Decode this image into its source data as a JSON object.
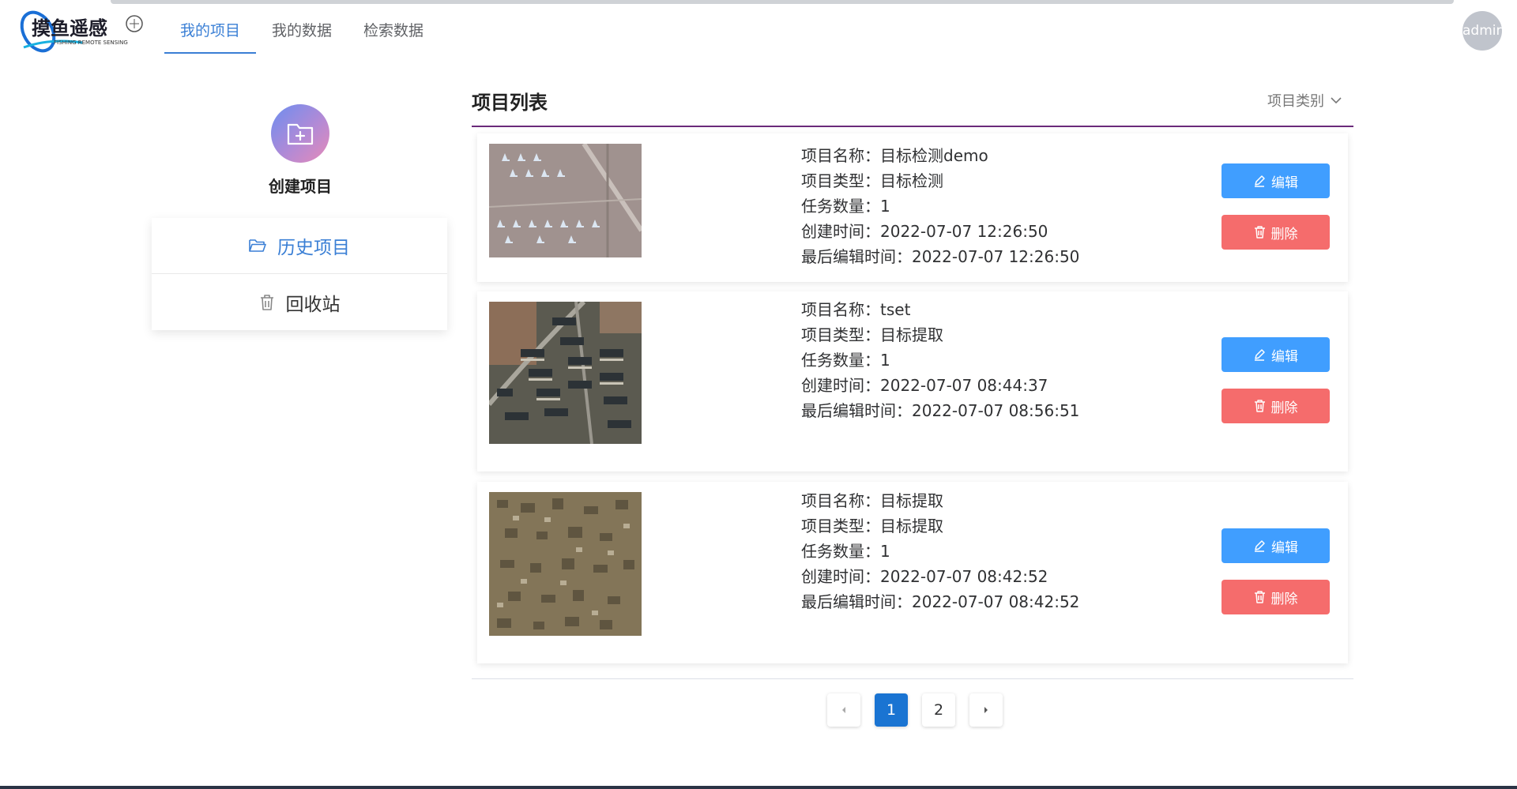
{
  "header": {
    "logo_text": "摸鱼遥感",
    "logo_subtext": "FISHING REMOTE SENSING",
    "nav": [
      {
        "label": "我的项目",
        "active": true
      },
      {
        "label": "我的数据",
        "active": false
      },
      {
        "label": "检索数据",
        "active": false
      }
    ],
    "user": "admin"
  },
  "sidebar": {
    "create_label": "创建项目",
    "items": [
      {
        "label": "历史项目",
        "icon": "folder-open-icon",
        "active": true
      },
      {
        "label": "回收站",
        "icon": "trash-icon",
        "active": false
      }
    ]
  },
  "main": {
    "title": "项目列表",
    "category_filter": "项目类别",
    "edit_label": "编辑",
    "delete_label": "删除",
    "projects": [
      {
        "name_line": "项目名称：目标检测demo",
        "type_line": "项目类型：目标检测",
        "tasks_line": "任务数量：1",
        "created_line": "创建时间：2022-07-07 12:26:50",
        "edited_line": "最后编辑时间：2022-07-07 12:26:50",
        "thumbnail": "airfield-satellite-image"
      },
      {
        "name_line": "项目名称：tset",
        "type_line": "项目类型：目标提取",
        "tasks_line": "任务数量：1",
        "created_line": "创建时间：2022-07-07 08:44:37",
        "edited_line": "最后编辑时间：2022-07-07 08:56:51",
        "thumbnail": "residential-buildings-satellite-image"
      },
      {
        "name_line": "项目名称：目标提取",
        "type_line": "项目类型：目标提取",
        "tasks_line": "任务数量：1",
        "created_line": "创建时间：2022-07-07 08:42:52",
        "edited_line": "最后编辑时间：2022-07-07 08:42:52",
        "thumbnail": "dense-village-satellite-image"
      }
    ]
  },
  "pagination": {
    "pages": [
      "1",
      "2"
    ],
    "current": "1"
  },
  "colors": {
    "primary": "#409eff",
    "danger": "#f56c6c",
    "nav_active": "#3a7fd5",
    "title_underline": "#6b2a7a",
    "page_active": "#1a74d2"
  }
}
